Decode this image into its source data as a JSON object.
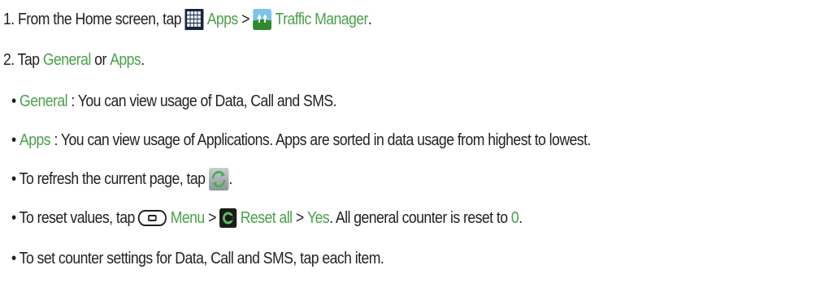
{
  "steps": {
    "step1": {
      "prefix": "1. From the Home screen, tap",
      "apps_label": "Apps",
      "separator": ">",
      "traffic_manager_label": "Traffic Manager",
      "period": "."
    },
    "step2": {
      "prefix": "2. Tap",
      "general_label": "General",
      "or": "or",
      "apps_label": "Apps",
      "period": "."
    }
  },
  "bullets": {
    "general": {
      "bullet": "•",
      "label": "General",
      "text": ": You can view usage of Data, Call and SMS."
    },
    "apps": {
      "bullet": "•",
      "label": "Apps",
      "text": ": You can view usage of Applications. Apps are sorted in data usage from highest to lowest."
    },
    "refresh": {
      "text": "• To refresh the current page, tap",
      "period": "."
    },
    "reset": {
      "text": "• To reset values, tap",
      "menu_label": "Menu",
      "separator": ">",
      "reset_all_label": "Reset all",
      "separator2": ">",
      "yes_label": "Yes",
      "text2": ". All general counter is reset to",
      "zero": "0",
      "period": "."
    },
    "counter": {
      "text": "• To set counter settings for Data, Call and SMS, tap each item."
    }
  },
  "icons": {
    "apps": "apps-grid-icon",
    "traffic_manager": "traffic-manager-icon",
    "refresh": "refresh-icon",
    "menu_key": "menu-key-icon",
    "reset": "reset-icon"
  },
  "colors": {
    "text": "#231f20",
    "highlight": "#4aa04a"
  }
}
